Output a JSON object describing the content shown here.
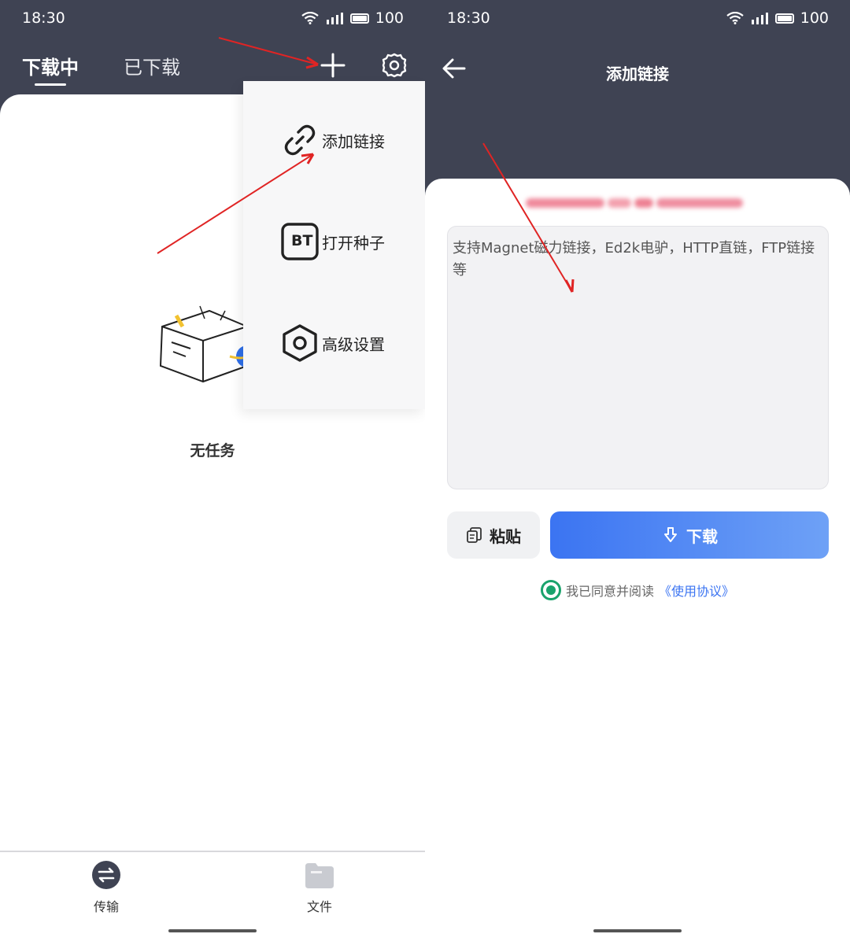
{
  "left_screen": {
    "status_bar": {
      "time": "18:30",
      "battery": "100"
    },
    "tabs": [
      {
        "label": "下载中",
        "active": true
      },
      {
        "label": "已下载",
        "active": false
      }
    ],
    "header_icons": [
      "plus-icon",
      "gear-icon"
    ],
    "dropdown_menu": [
      {
        "label": "添加链接",
        "icon": "link-icon"
      },
      {
        "label": "打开种子",
        "icon": "bt-icon",
        "icon_text": "BT"
      },
      {
        "label": "高级设置",
        "icon": "settings-hexagon-icon"
      }
    ],
    "empty_state": {
      "text": "无任务",
      "icon": "empty-box-icon"
    },
    "bottom_nav": [
      {
        "label": "传输",
        "icon": "transfer-icon",
        "active": true
      },
      {
        "label": "文件",
        "icon": "folder-icon",
        "active": false
      }
    ]
  },
  "right_screen": {
    "status_bar": {
      "time": "18:30",
      "battery": "100"
    },
    "title": "添加链接",
    "link_input": {
      "placeholder": "支持Magnet磁力链接，Ed2k电驴，HTTP直链，FTP链接等"
    },
    "paste_button": {
      "label": "粘贴"
    },
    "download_button": {
      "label": "下载"
    },
    "agreement": {
      "text": "我已同意并阅读",
      "link": "《使用协议》"
    }
  },
  "colors": {
    "header_bg": "#3f4353",
    "accent_blue": "#3b74f2",
    "agree_green": "#1aa36c",
    "annotation_red": "#e02424"
  }
}
